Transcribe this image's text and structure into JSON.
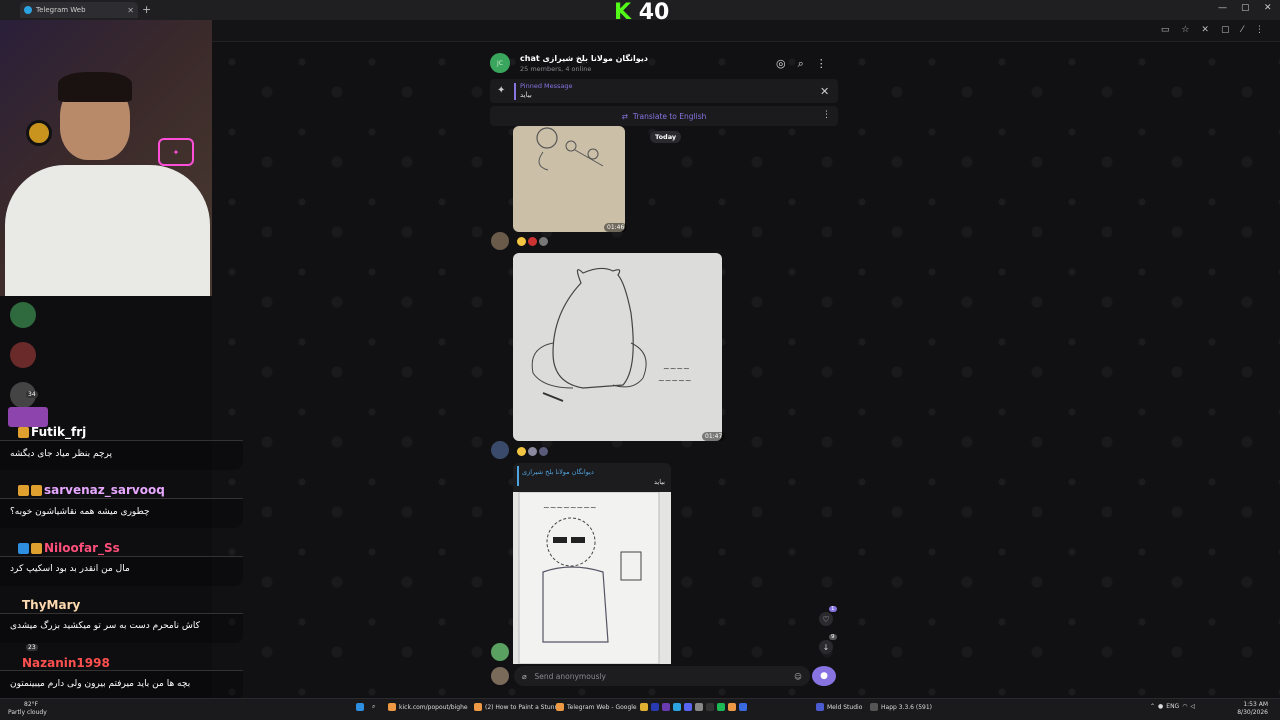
{
  "browser": {
    "tab_title": "Telegram Web",
    "new_tab_label": "+",
    "window_controls": [
      "—",
      "▢",
      "✕"
    ]
  },
  "stream_logo": {
    "k": "K",
    "number": "40"
  },
  "chat": {
    "title": "chat دیوانگان مولانا بلخ شیرازی",
    "subtitle": "25 members, 4 online",
    "avatar_text": "JC",
    "pinned_label": "Pinned Message",
    "pinned_text": "بیاید",
    "translate_label": "Translate to English",
    "date_separator": "Today",
    "messages": [
      {
        "time": "01:46"
      },
      {
        "time": "01:47"
      },
      {
        "reply_name": "دیوانگان مولانا بلخ شیرازی",
        "reply_text": "بیاید"
      }
    ],
    "composer_placeholder": "Send anonymously",
    "unread_mentions": "1",
    "unread_count": "9"
  },
  "stream_chat": [
    {
      "user": "Futik_frj",
      "color": "#ffffff",
      "message": "پرچم بنظر میاد جای دیگشه"
    },
    {
      "user": "sarvenaz_sarvooq",
      "color": "#e6a7ff",
      "message": "چطوری میشه همه نقاشیاشون خوبه؟"
    },
    {
      "user": "Niloofar_Ss",
      "color": "#ff4f7b",
      "message": "مال من انقدر بد بود اسکیپ کرد"
    },
    {
      "user": "ThyMary",
      "color": "#ffd9b0",
      "message": "کاش نامحرم دست به سر تو میکشید بزرگ میشدی"
    },
    {
      "user": "Nazanin1998",
      "color": "#ff5050",
      "message": "بچه ها من باید میرفتم بیرون ولی دارم میبینمتون"
    }
  ],
  "sidebar_badge": "34",
  "sidebar_badge2": "23",
  "taskbar": {
    "weather_temp": "82°F",
    "weather_desc": "Partly cloudy",
    "items": [
      "kick.com/popout/bighe",
      "(2) How to Paint a Stunr",
      "Telegram Web - Google",
      "Meld Studio",
      "Happ 3.3.6 (591)"
    ],
    "lang": "ENG",
    "time": "1:53 AM",
    "date": "8/30/2026"
  },
  "colors": {
    "accent": "#8774e1",
    "kick_green": "#53fc18",
    "avatar_green": "#3aa55c"
  }
}
